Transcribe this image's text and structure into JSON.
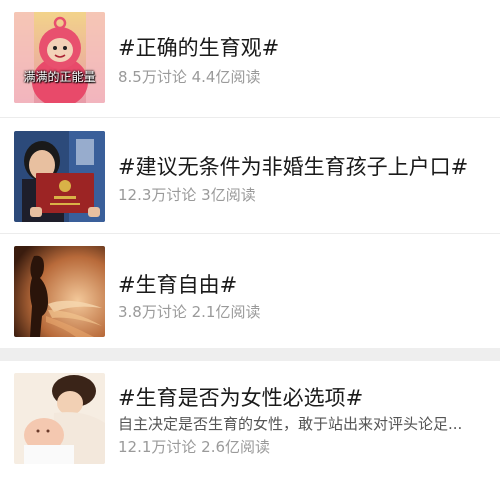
{
  "topics": [
    {
      "title": "#正确的生育观#",
      "meta": "8.5万讨论 4.4亿阅读",
      "thumb_caption": "满满的正能量",
      "thumb_icon": "cartoon-character-image"
    },
    {
      "title": "#建议无条件为非婚生育孩子上户口#",
      "meta": "12.3万讨论 3亿阅读",
      "thumb_icon": "household-register-booklet-image"
    },
    {
      "title": "#生育自由#",
      "meta": "3.8万讨论 2.1亿阅读",
      "thumb_icon": "pregnant-silhouette-image"
    },
    {
      "title": "#生育是否为女性必选项#",
      "description": "自主决定是否生育的女性，敢于站出来对评头论足...",
      "meta": "12.1万讨论 2.6亿阅读",
      "thumb_icon": "mother-and-baby-image"
    }
  ],
  "colors": {
    "title": "#1a1a1a",
    "meta": "#9a9a9a",
    "divider": "#ececec",
    "section_gap": "#eeeeee"
  }
}
